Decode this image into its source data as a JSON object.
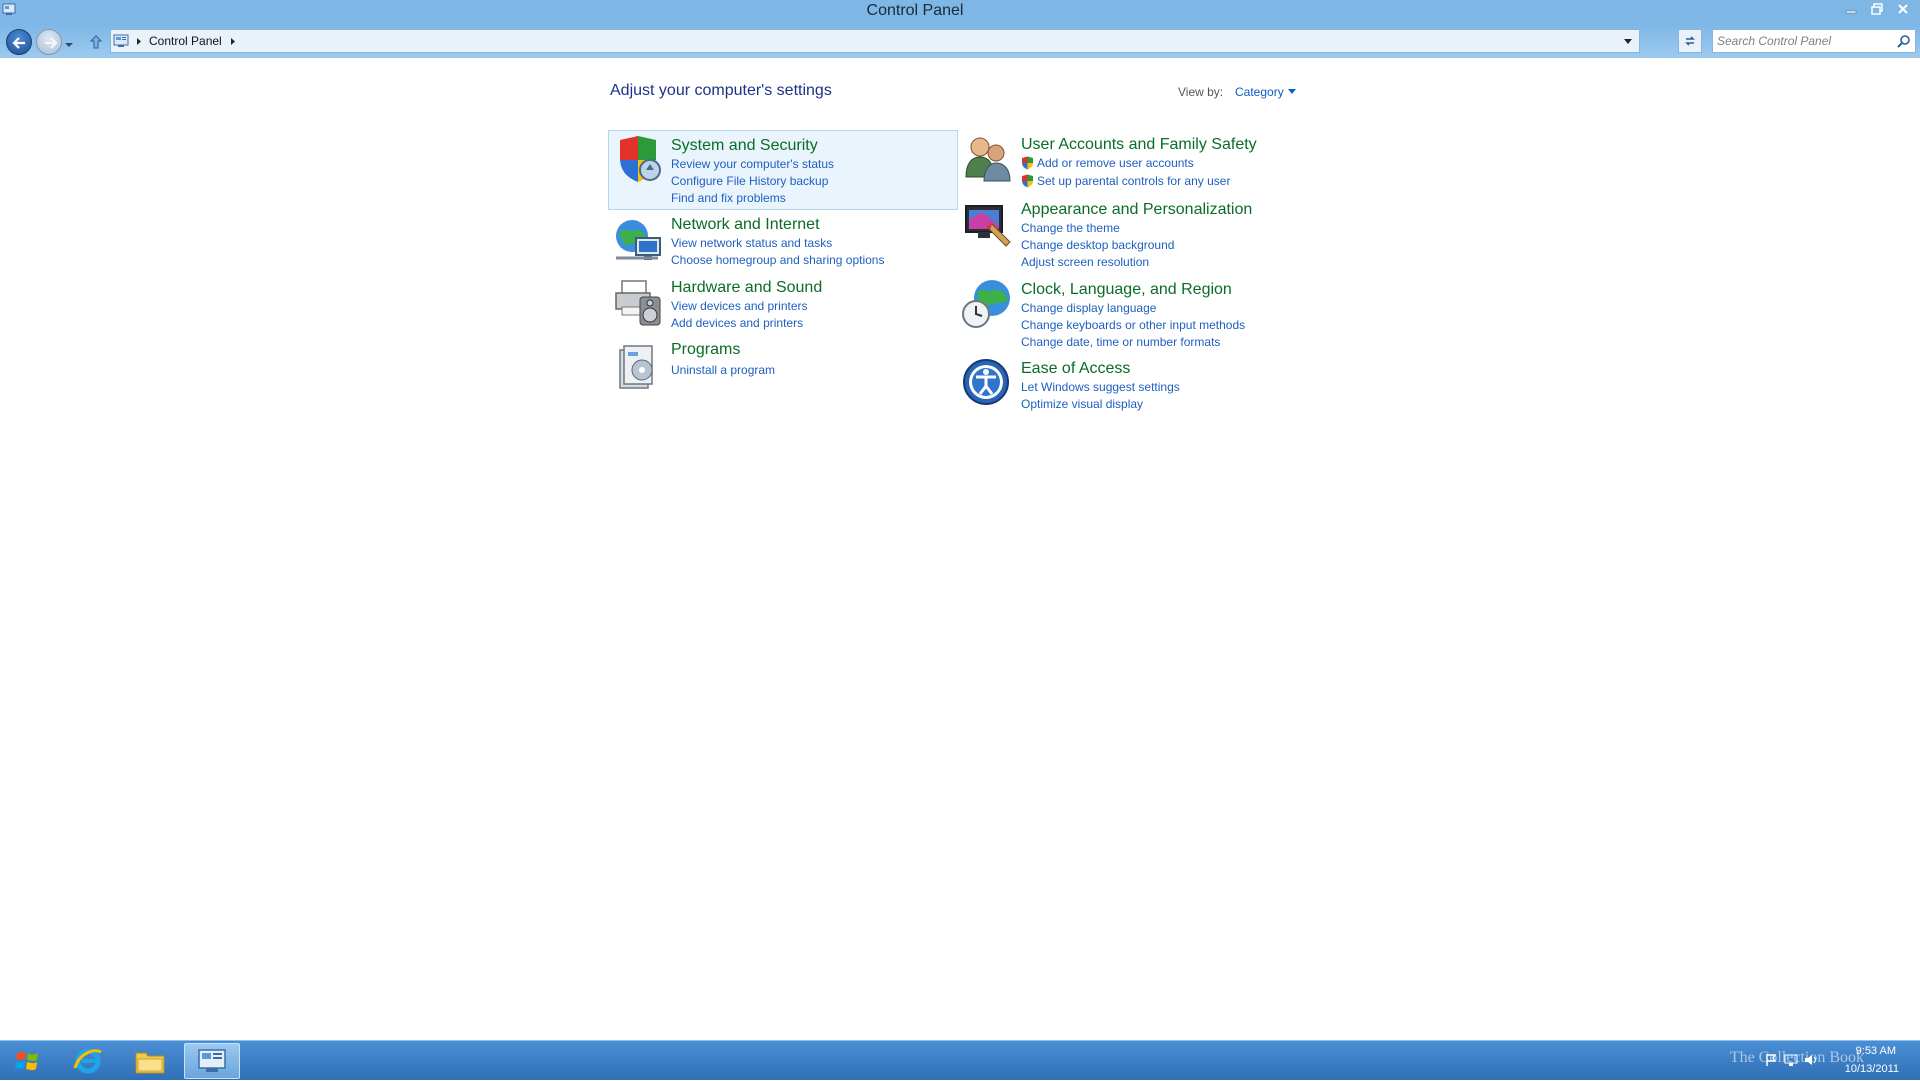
{
  "window": {
    "title": "Control Panel"
  },
  "navigation": {
    "breadcrumb": [
      "Control Panel"
    ],
    "search_placeholder": "Search Control Panel"
  },
  "main": {
    "heading": "Adjust your computer's settings",
    "view_by_label": "View by:",
    "view_by_value": "Category",
    "categories": [
      {
        "title": "System and Security",
        "icon": "shield-icon",
        "links": [
          "Review your computer's status",
          "Configure File History backup",
          "Find and fix problems"
        ]
      },
      {
        "title": "Network and Internet",
        "icon": "network-globe-icon",
        "links": [
          "View network status and tasks",
          "Choose homegroup and sharing options"
        ]
      },
      {
        "title": "Hardware and Sound",
        "icon": "printer-speaker-icon",
        "links": [
          "View devices and printers",
          "Add devices and printers"
        ]
      },
      {
        "title": "Programs",
        "icon": "programs-box-icon",
        "links": [
          "Uninstall a program"
        ]
      },
      {
        "title": "User Accounts and Family Safety",
        "icon": "users-icon",
        "links": [
          "Add or remove user accounts",
          "Set up parental controls for any user"
        ]
      },
      {
        "title": "Appearance and Personalization",
        "icon": "monitor-paint-icon",
        "links": [
          "Change the theme",
          "Change desktop background",
          "Adjust screen resolution"
        ]
      },
      {
        "title": "Clock, Language, and Region",
        "icon": "clock-globe-icon",
        "links": [
          "Change display language",
          "Change keyboards or other input methods",
          "Change date, time or number formats"
        ]
      },
      {
        "title": "Ease of Access",
        "icon": "ease-of-access-icon",
        "links": [
          "Let Windows suggest settings",
          "Optimize visual display"
        ]
      }
    ]
  },
  "taskbar": {
    "apps": [
      "start-orb-icon",
      "internet-explorer-icon",
      "file-explorer-icon",
      "control-panel-icon"
    ],
    "clock_time": "9:53 AM",
    "clock_date": "10/13/2011",
    "watermark": "The Collection Book"
  },
  "colors": {
    "titlebar": "#7eb6e6",
    "heading": "#1e3287",
    "category_title": "#0b6c26",
    "link": "#1f5fbf",
    "taskbar": "#3a7cc4"
  }
}
